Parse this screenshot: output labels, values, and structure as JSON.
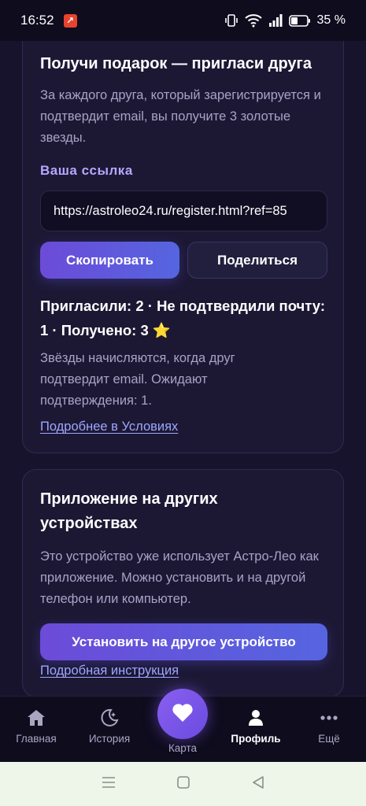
{
  "status_bar": {
    "time": "16:52",
    "battery": "35 %"
  },
  "referral": {
    "title": "Получи подарок — пригласи друга",
    "description": "За каждого друга, который зарегистрируется и подтвердит email, вы получите 3 золотые звезды.",
    "link_label": "Ваша ссылка",
    "link_value": "https://astroleo24.ru/register.html?ref=85",
    "copy_button": "Скопировать",
    "share_button": "Поделиться",
    "stats": "Пригласили: 2 · Не подтвердили почту: 1 · Получено: 3",
    "stats_icon": "⭐",
    "note": "Звёзды начисляются, когда друг подтвердит email. Ожидают подтверждения: 1.",
    "terms_link": "Подробнее в Условиях"
  },
  "other_devices": {
    "title": "Приложение на других устройствах",
    "description": "Это устройство уже использует Астро-Лео как приложение. Можно установить и на другой телефон или компьютер.",
    "install_button": "Установить на другое устройство",
    "instructions_link": "Подробная инструкция"
  },
  "bottom_nav": {
    "items": [
      {
        "label": "Главная",
        "icon": "home-icon"
      },
      {
        "label": "История",
        "icon": "moon-stars-icon"
      },
      {
        "label": "Карта",
        "icon": "heart-icon"
      },
      {
        "label": "Профиль",
        "icon": "person-icon"
      },
      {
        "label": "Ещё",
        "icon": "more-dots-icon"
      }
    ],
    "active": "Профиль"
  },
  "colors": {
    "background": "#17132d",
    "card": "#1c1834",
    "accent": "#6c4bd8",
    "link": "#9fa6ff"
  }
}
